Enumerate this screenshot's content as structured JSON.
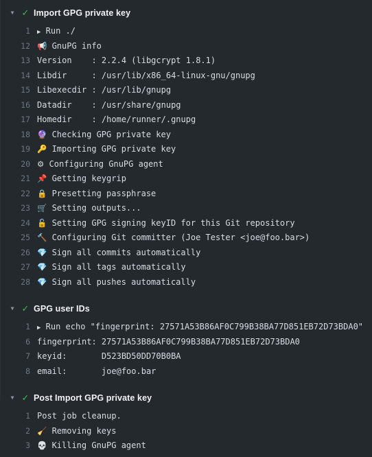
{
  "theme": {
    "background": "#24292e",
    "text": "#d8dde3",
    "line_number": "#6e7681",
    "title": "#f0f3f6",
    "success": "#3fb950",
    "chevron": "#8b949e"
  },
  "icons": {
    "chevron_down": "▼",
    "check": "✓",
    "run_caret": "▶",
    "megaphone": "📢",
    "crystal_ball": "🔮",
    "key": "🔑",
    "gear": "⚙",
    "pushpin": "📌",
    "lock": "🔒",
    "cart": "🛒",
    "unlock": "🔓",
    "hammer": "🔨",
    "gem": "💎",
    "broom": "🧹",
    "skull": "💀"
  },
  "groups": [
    {
      "title": "Import GPG private key",
      "status": "success",
      "expanded": true,
      "lines": [
        {
          "n": "1",
          "icon": "run_caret",
          "text": "Run ./"
        },
        {
          "n": "12",
          "icon": "megaphone",
          "text": "GnuPG info"
        },
        {
          "n": "13",
          "icon": "",
          "text": "Version    : 2.2.4 (libgcrypt 1.8.1)"
        },
        {
          "n": "14",
          "icon": "",
          "text": "Libdir     : /usr/lib/x86_64-linux-gnu/gnupg"
        },
        {
          "n": "15",
          "icon": "",
          "text": "Libexecdir : /usr/lib/gnupg"
        },
        {
          "n": "16",
          "icon": "",
          "text": "Datadir    : /usr/share/gnupg"
        },
        {
          "n": "17",
          "icon": "",
          "text": "Homedir    : /home/runner/.gnupg"
        },
        {
          "n": "18",
          "icon": "crystal_ball",
          "text": "Checking GPG private key"
        },
        {
          "n": "19",
          "icon": "key",
          "text": "Importing GPG private key"
        },
        {
          "n": "20",
          "icon": "gear",
          "text": "Configuring GnuPG agent"
        },
        {
          "n": "21",
          "icon": "pushpin",
          "text": "Getting keygrip"
        },
        {
          "n": "22",
          "icon": "lock",
          "text": "Presetting passphrase"
        },
        {
          "n": "23",
          "icon": "cart",
          "text": "Setting outputs..."
        },
        {
          "n": "24",
          "icon": "unlock",
          "text": "Setting GPG signing keyID for this Git repository"
        },
        {
          "n": "25",
          "icon": "hammer",
          "text": "Configuring Git committer (Joe Tester <joe@foo.bar>)"
        },
        {
          "n": "26",
          "icon": "gem",
          "text": "Sign all commits automatically"
        },
        {
          "n": "27",
          "icon": "gem",
          "text": "Sign all tags automatically"
        },
        {
          "n": "28",
          "icon": "gem",
          "text": "Sign all pushes automatically"
        }
      ]
    },
    {
      "title": "GPG user IDs",
      "status": "success",
      "expanded": true,
      "lines": [
        {
          "n": "1",
          "icon": "run_caret",
          "text": "Run echo \"fingerprint: 27571A53B86AF0C799B38BA77D851EB72D73BDA0\""
        },
        {
          "n": "6",
          "icon": "",
          "text": "fingerprint: 27571A53B86AF0C799B38BA77D851EB72D73BDA0"
        },
        {
          "n": "7",
          "icon": "",
          "text": "keyid:       D523BD50DD70B0BA"
        },
        {
          "n": "8",
          "icon": "",
          "text": "email:       joe@foo.bar"
        }
      ]
    },
    {
      "title": "Post Import GPG private key",
      "status": "success",
      "expanded": true,
      "lines": [
        {
          "n": "1",
          "icon": "",
          "text": "Post job cleanup."
        },
        {
          "n": "2",
          "icon": "broom",
          "text": "Removing keys"
        },
        {
          "n": "3",
          "icon": "skull",
          "text": "Killing GnuPG agent"
        }
      ]
    }
  ]
}
